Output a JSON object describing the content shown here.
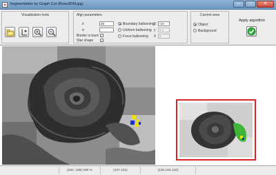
{
  "window": {
    "title": "Segmentation by Graph Cut (Rose3DM.jpg)"
  },
  "toolbar": {
    "visualization": {
      "title": "Visualization tools",
      "tools": [
        "load-image-icon",
        "brush-tool-icon",
        "zoom-in-icon",
        "zoom-out-icon"
      ]
    },
    "algo": {
      "title": "Algo parameters",
      "lambda_label": "λ",
      "lambda_value": "20",
      "sigma_label": "σ",
      "sigma_value": "",
      "border_label": "Border is back",
      "border_checked": "✓",
      "star_label": "Star shape",
      "star_checked": "✓",
      "balloon_options": [
        "Boundary ballooning",
        "Uniform ballooning",
        "Force ballooning"
      ],
      "selected_balloon": "Boundary ballooning",
      "beta_label": "β",
      "beta_value": "-10",
      "gamma_label": "γ",
      "gamma_value": "0.1",
      "delta_label": "δ",
      "delta_value": "5"
    },
    "current_area": {
      "title": "Current area",
      "options": [
        "Object",
        "Background"
      ],
      "selected": "Object"
    },
    "apply": {
      "title": "Apply algorithm",
      "icon": "checkmark-icon"
    }
  },
  "status": {
    "cell1": "",
    "cell2": "(250, 188) 260 %",
    "cell3": "(247,101)",
    "cell4": "(132,132,132)",
    "cell5": ""
  },
  "colors": {
    "preview_border": "#d82424",
    "segment_highlight": "#3fb53a",
    "marker_yellow": "#f4e000",
    "marker_blue": "#1b2fd0"
  }
}
